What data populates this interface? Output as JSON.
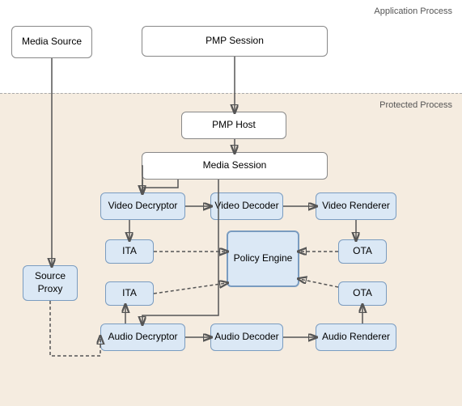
{
  "labels": {
    "app_process": "Application Process",
    "protected_process": "Protected Process"
  },
  "boxes": {
    "media_source": "Media Source",
    "pmp_session": "PMP Session",
    "pmp_host": "PMP Host",
    "media_session": "Media Session",
    "video_decryptor": "Video Decryptor",
    "video_decoder": "Video Decoder",
    "video_renderer": "Video Renderer",
    "ita_top": "ITA",
    "ota_top": "OTA",
    "policy_engine": "Policy\nEngine",
    "ita_bottom": "ITA",
    "ota_bottom": "OTA",
    "audio_decryptor": "Audio Decryptor",
    "audio_decoder": "Audio Decoder",
    "audio_renderer": "Audio Renderer",
    "source_proxy": "Source\nProxy"
  }
}
